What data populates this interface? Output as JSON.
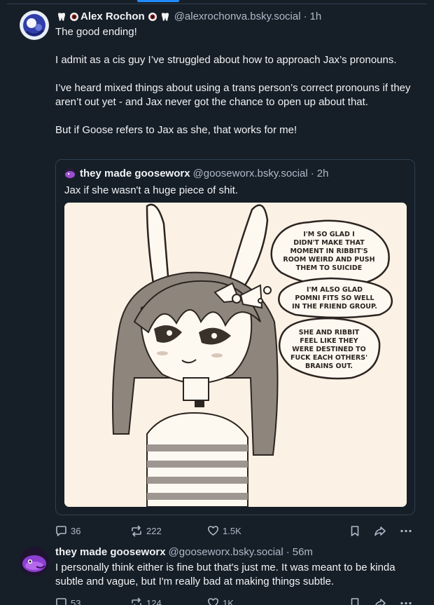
{
  "post1": {
    "display_name": "Alex Rochon",
    "handle": "@alexrochonva.bsky.social",
    "separator": "·",
    "time": "1h",
    "paragraphs": [
      "The good ending!",
      "I admit as a cis guy I’ve struggled about how to approach Jax’s pronouns.",
      "I’ve heard mixed things about using a trans person’s correct pronouns if they aren’t out yet - and Jax never got the chance to open up about that.",
      "But if Goose refers to Jax as she, that works for me!"
    ],
    "quote": {
      "display_name": "they made gooseworx",
      "handle": "@gooseworx.bsky.social",
      "separator": "·",
      "time": "2h",
      "text": "Jax if she wasn't a huge piece of shit.",
      "image": {
        "bubble1": [
          "I'M SO GLAD I",
          "DIDN'T MAKE THAT",
          "MOMENT IN RIBBIT'S",
          "ROOM WEIRD AND PUSH",
          "THEM TO SUICIDE"
        ],
        "bubble2": [
          "I'M ALSO GLAD",
          "POMNI FITS SO WELL",
          "IN THE FRIEND GROUP."
        ],
        "bubble3": [
          "SHE AND RIBBIT",
          "FEEL LIKE THEY",
          "WERE DESTINED TO",
          "FUCK EACH OTHERS'",
          "BRAINS OUT."
        ]
      }
    },
    "actions": {
      "replies": "36",
      "reposts": "222",
      "likes": "1.5K"
    }
  },
  "post2": {
    "display_name": "they made gooseworx",
    "handle": "@gooseworx.bsky.social",
    "separator": "·",
    "time": "56m",
    "text": "I personally think either is fine but that's just me. It was meant to be kinda subtle and vague, but I'm really bad at making things subtle.",
    "actions": {
      "replies": "53",
      "reposts": "124",
      "likes": "1K"
    }
  },
  "icons": {
    "reply": "reply-icon",
    "repost": "repost-icon",
    "like": "heart-icon",
    "bookmark": "bookmark-icon",
    "share": "share-icon",
    "more": "more-icon"
  },
  "colors": {
    "background": "#161e27",
    "border": "#2e4052",
    "muted": "#aebbc9",
    "accent": "#208bfe"
  }
}
